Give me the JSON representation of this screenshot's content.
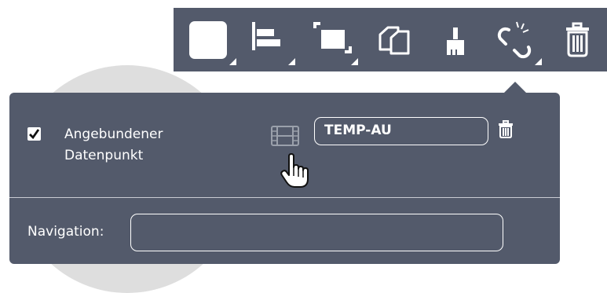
{
  "toolbar": {
    "buttons": [
      {
        "icon": "square-fill-icon",
        "has_dropdown": true
      },
      {
        "icon": "align-left-icon",
        "has_dropdown": true
      },
      {
        "icon": "resize-icon",
        "has_dropdown": true
      },
      {
        "icon": "copy-icon",
        "has_dropdown": false
      },
      {
        "icon": "paint-brush-icon",
        "has_dropdown": false
      },
      {
        "icon": "unlink-icon",
        "has_dropdown": true
      },
      {
        "icon": "trash-icon",
        "has_dropdown": false
      }
    ]
  },
  "popover": {
    "bound_checked": true,
    "bound_label": "Angebundener Datenpunkt",
    "datapoint_value": "TEMP-AU",
    "navigation_label": "Navigation:",
    "navigation_value": ""
  },
  "colors": {
    "panel": "#535a6b",
    "foreground": "#ffffff",
    "icon_muted": "#9aa0ab",
    "backdrop_circle": "#dedede"
  }
}
